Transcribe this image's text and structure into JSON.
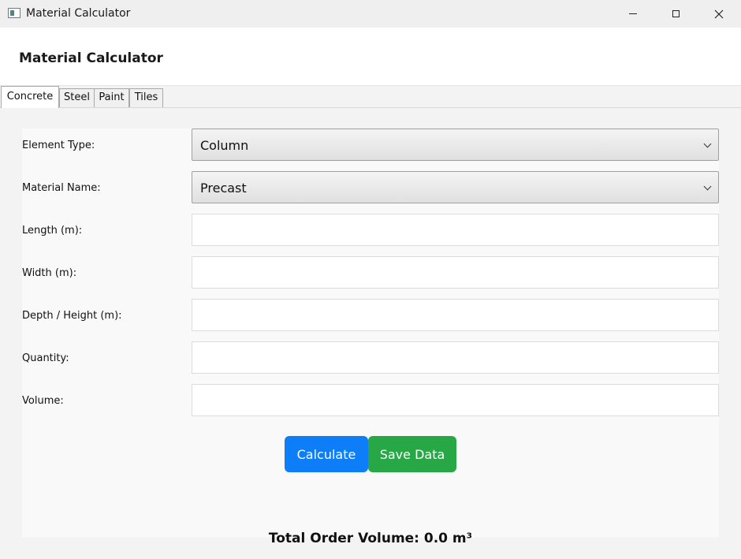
{
  "window": {
    "title": "Material Calculator"
  },
  "header": {
    "title": "Material Calculator"
  },
  "tabs": [
    {
      "label": "Concrete"
    },
    {
      "label": "Steel"
    },
    {
      "label": "Paint"
    },
    {
      "label": "Tiles"
    }
  ],
  "form": {
    "element_type": {
      "label": "Element Type:",
      "value": "Column"
    },
    "material_name": {
      "label": "Material Name:",
      "value": "Precast"
    },
    "length": {
      "label": "Length (m):",
      "value": ""
    },
    "width": {
      "label": "Width (m):",
      "value": ""
    },
    "depth": {
      "label": "Depth / Height (m):",
      "value": ""
    },
    "quantity": {
      "label": "Quantity:",
      "value": ""
    },
    "volume": {
      "label": "Volume:",
      "value": ""
    }
  },
  "buttons": {
    "calculate": "Calculate",
    "save": "Save Data"
  },
  "total": "Total Order Volume: 0.0 m³",
  "colors": {
    "primary": "#0d7ef7",
    "success": "#27a745"
  }
}
